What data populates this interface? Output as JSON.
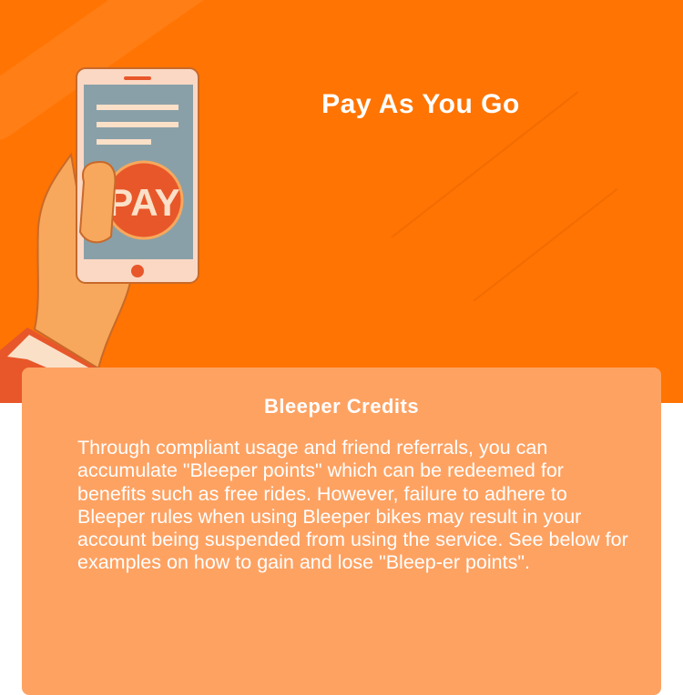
{
  "hero": {
    "title": "Pay As You Go",
    "phone_button_label": "PAY",
    "background_color": "#ff7402"
  },
  "card": {
    "title": "Bleeper Credits",
    "body": "Through compliant usage and friend referrals, you can accumulate \"Bleeper points\" which can be redeemed for benefits such as free rides. However, failure to adhere to Bleeper rules when using Bleeper bikes may result in your account being suspended from using the service. See below for examples on how to gain and lose \"Bleep-er points\".",
    "background_color": "#fea262"
  },
  "icons": {
    "illustration": "hand-holding-phone-pay-icon"
  }
}
